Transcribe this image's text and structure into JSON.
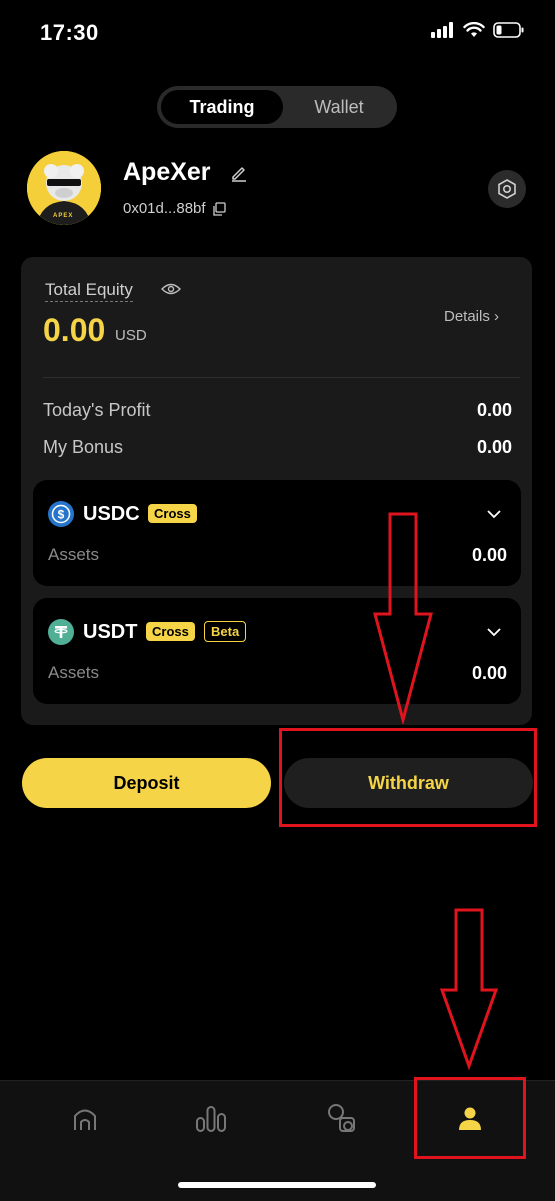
{
  "status_bar": {
    "time": "17:30"
  },
  "tabs": [
    {
      "label": "Trading",
      "active": true
    },
    {
      "label": "Wallet",
      "active": false
    }
  ],
  "profile": {
    "username": "ApeXer",
    "address": "0x01d...88bf",
    "avatar_text": "APEX"
  },
  "equity": {
    "label": "Total Equity",
    "value": "0.00",
    "unit": "USD",
    "details_label": "Details",
    "rows": [
      {
        "label": "Today's Profit",
        "value": "0.00"
      },
      {
        "label": "My Bonus",
        "value": "0.00"
      }
    ]
  },
  "assets": [
    {
      "coin": "USDC",
      "badges": [
        "Cross"
      ],
      "assets_label": "Assets",
      "value": "0.00",
      "icon_color": "#2775ca"
    },
    {
      "coin": "USDT",
      "badges": [
        "Cross",
        "Beta"
      ],
      "assets_label": "Assets",
      "value": "0.00",
      "icon_color": "#50af95"
    }
  ],
  "buttons": {
    "deposit": "Deposit",
    "withdraw": "Withdraw"
  },
  "colors": {
    "accent": "#f5d547",
    "annotation": "#e0141e",
    "background": "#000000"
  },
  "nav": [
    {
      "icon": "home-icon",
      "active": false
    },
    {
      "icon": "markets-icon",
      "active": false
    },
    {
      "icon": "trade-icon",
      "active": false
    },
    {
      "icon": "profile-icon",
      "active": true
    }
  ]
}
